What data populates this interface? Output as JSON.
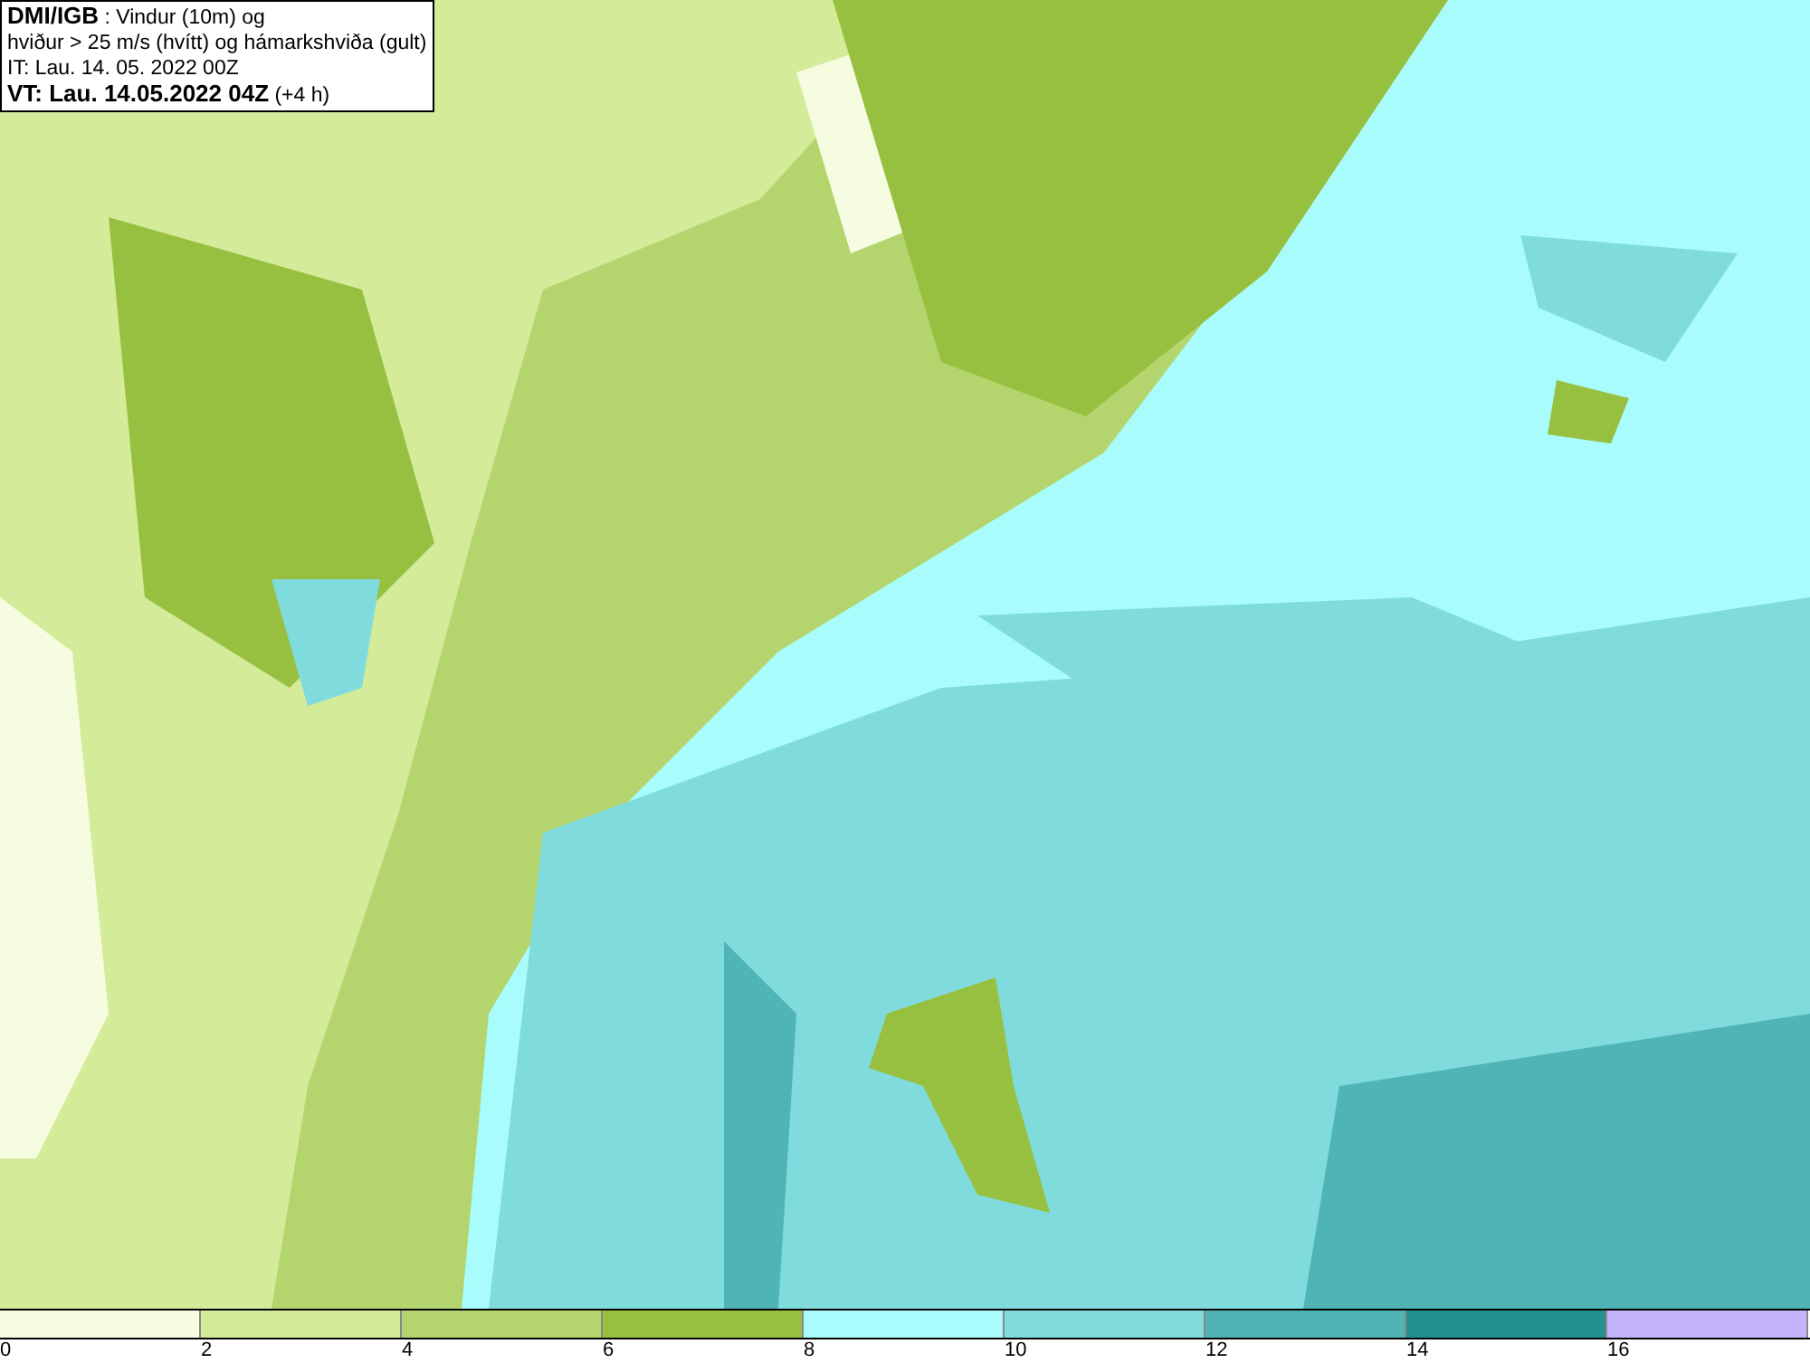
{
  "caption": {
    "lines": [
      "**DMI/IGB** : Vindur (10m) og",
      "hviður > 25 m/s (hvítt) og hámarkshviða (gult)",
      "IT: Lau. 14. 05. 2022 00Z",
      "**VT: Lau. 14.05.2022 04Z** (+4 h)"
    ]
  },
  "legend": {
    "bins": [
      {
        "color": "#f5fce0"
      },
      {
        "color": "#d4eb9a"
      },
      {
        "color": "#b4d56e"
      },
      {
        "color": "#98c040"
      },
      {
        "color": "#a8fcfc"
      },
      {
        "color": "#80dcdc"
      },
      {
        "color": "#50b4b4"
      },
      {
        "color": "#249090"
      },
      {
        "color": "#c4b4fc"
      }
    ],
    "ticks": [
      "0",
      "2",
      "4",
      "6",
      "8",
      "10",
      "12",
      "14",
      "16"
    ]
  }
}
